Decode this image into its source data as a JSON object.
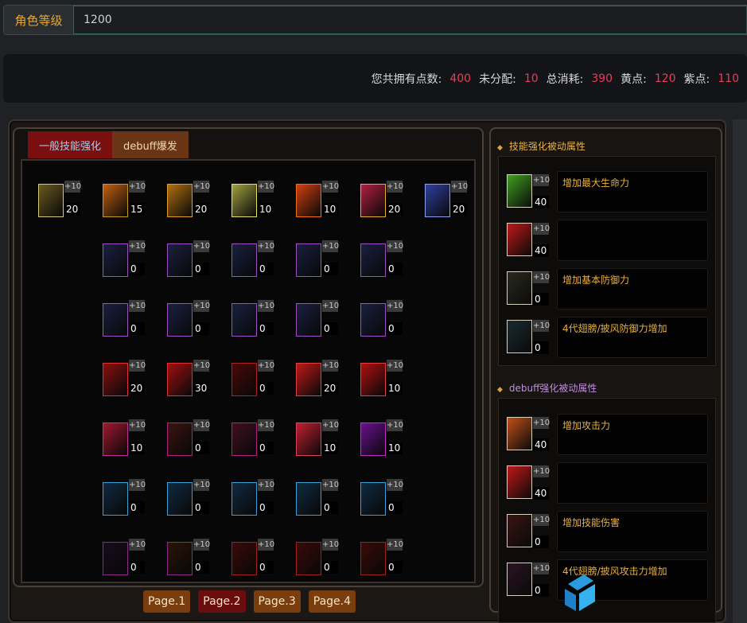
{
  "level": {
    "label": "角色等级",
    "value": "1200"
  },
  "points": [
    {
      "label": "您共拥有点数:",
      "value": "400"
    },
    {
      "label": "未分配:",
      "value": "10"
    },
    {
      "label": "总消耗:",
      "value": "390"
    },
    {
      "label": "黄点:",
      "value": "120"
    },
    {
      "label": "紫点:",
      "value": "110"
    }
  ],
  "tabs": [
    {
      "label": "一般技能强化",
      "active": true
    },
    {
      "label": "debuff爆发",
      "active": false
    }
  ],
  "skill_rows": [
    [
      {
        "plus": "+10",
        "count": "20"
      },
      {
        "plus": "+10",
        "count": "15"
      },
      {
        "plus": "+10",
        "count": "20"
      },
      {
        "plus": "+10",
        "count": "10"
      },
      {
        "plus": "+10",
        "count": "10"
      },
      {
        "plus": "+10",
        "count": "20"
      },
      {
        "plus": "+10",
        "count": "20"
      }
    ],
    [
      {
        "plus": "+10",
        "count": "0"
      },
      {
        "plus": "+10",
        "count": "0"
      },
      {
        "plus": "+10",
        "count": "0"
      },
      {
        "plus": "+10",
        "count": "0"
      },
      {
        "plus": "+10",
        "count": "0"
      }
    ],
    [
      {
        "plus": "+10",
        "count": "0"
      },
      {
        "plus": "+10",
        "count": "0"
      },
      {
        "plus": "+10",
        "count": "0"
      },
      {
        "plus": "+10",
        "count": "0"
      },
      {
        "plus": "+10",
        "count": "0"
      }
    ],
    [
      {
        "plus": "+10",
        "count": "20"
      },
      {
        "plus": "+10",
        "count": "30"
      },
      {
        "plus": "+10",
        "count": "0"
      },
      {
        "plus": "+10",
        "count": "20"
      },
      {
        "plus": "+10",
        "count": "10"
      }
    ],
    [
      {
        "plus": "+10",
        "count": "10"
      },
      {
        "plus": "+10",
        "count": "0"
      },
      {
        "plus": "+10",
        "count": "0"
      },
      {
        "plus": "+10",
        "count": "10"
      },
      {
        "plus": "+10",
        "count": "10"
      }
    ],
    [
      {
        "plus": "+10",
        "count": "0"
      },
      {
        "plus": "+10",
        "count": "0"
      },
      {
        "plus": "+10",
        "count": "0"
      },
      {
        "plus": "+10",
        "count": "0"
      },
      {
        "plus": "+10",
        "count": "0"
      }
    ],
    [
      {
        "plus": "+10",
        "count": "0"
      },
      {
        "plus": "+10",
        "count": "0"
      },
      {
        "plus": "+10",
        "count": "0"
      },
      {
        "plus": "+10",
        "count": "0"
      },
      {
        "plus": "+10",
        "count": "0"
      }
    ]
  ],
  "pages": [
    "Page.1",
    "Page.2",
    "Page.3",
    "Page.4"
  ],
  "passive_sections": [
    {
      "title": "技能强化被动属性",
      "items": [
        {
          "plus": "+10",
          "count": "40",
          "desc": "增加最大生命力"
        },
        {
          "plus": "+10",
          "count": "40",
          "desc": ""
        },
        {
          "plus": "+10",
          "count": "0",
          "desc": "增加基本防御力"
        },
        {
          "plus": "+10",
          "count": "0",
          "desc": "4代翅膀/披风防御力增加"
        }
      ]
    },
    {
      "title": "debuff强化被动属性",
      "items": [
        {
          "plus": "+10",
          "count": "40",
          "desc": "增加攻击力"
        },
        {
          "plus": "+10",
          "count": "40",
          "desc": ""
        },
        {
          "plus": "+10",
          "count": "0",
          "desc": "增加技能伤害"
        },
        {
          "plus": "+10",
          "count": "0",
          "desc": "4代翅膀/披风攻击力增加"
        }
      ]
    }
  ],
  "colors": {
    "accent_gold": "#e9b13f",
    "value_red": "#ee3b57",
    "tab_active": "#7a0f10",
    "tab_inactive": "#6a3514"
  }
}
